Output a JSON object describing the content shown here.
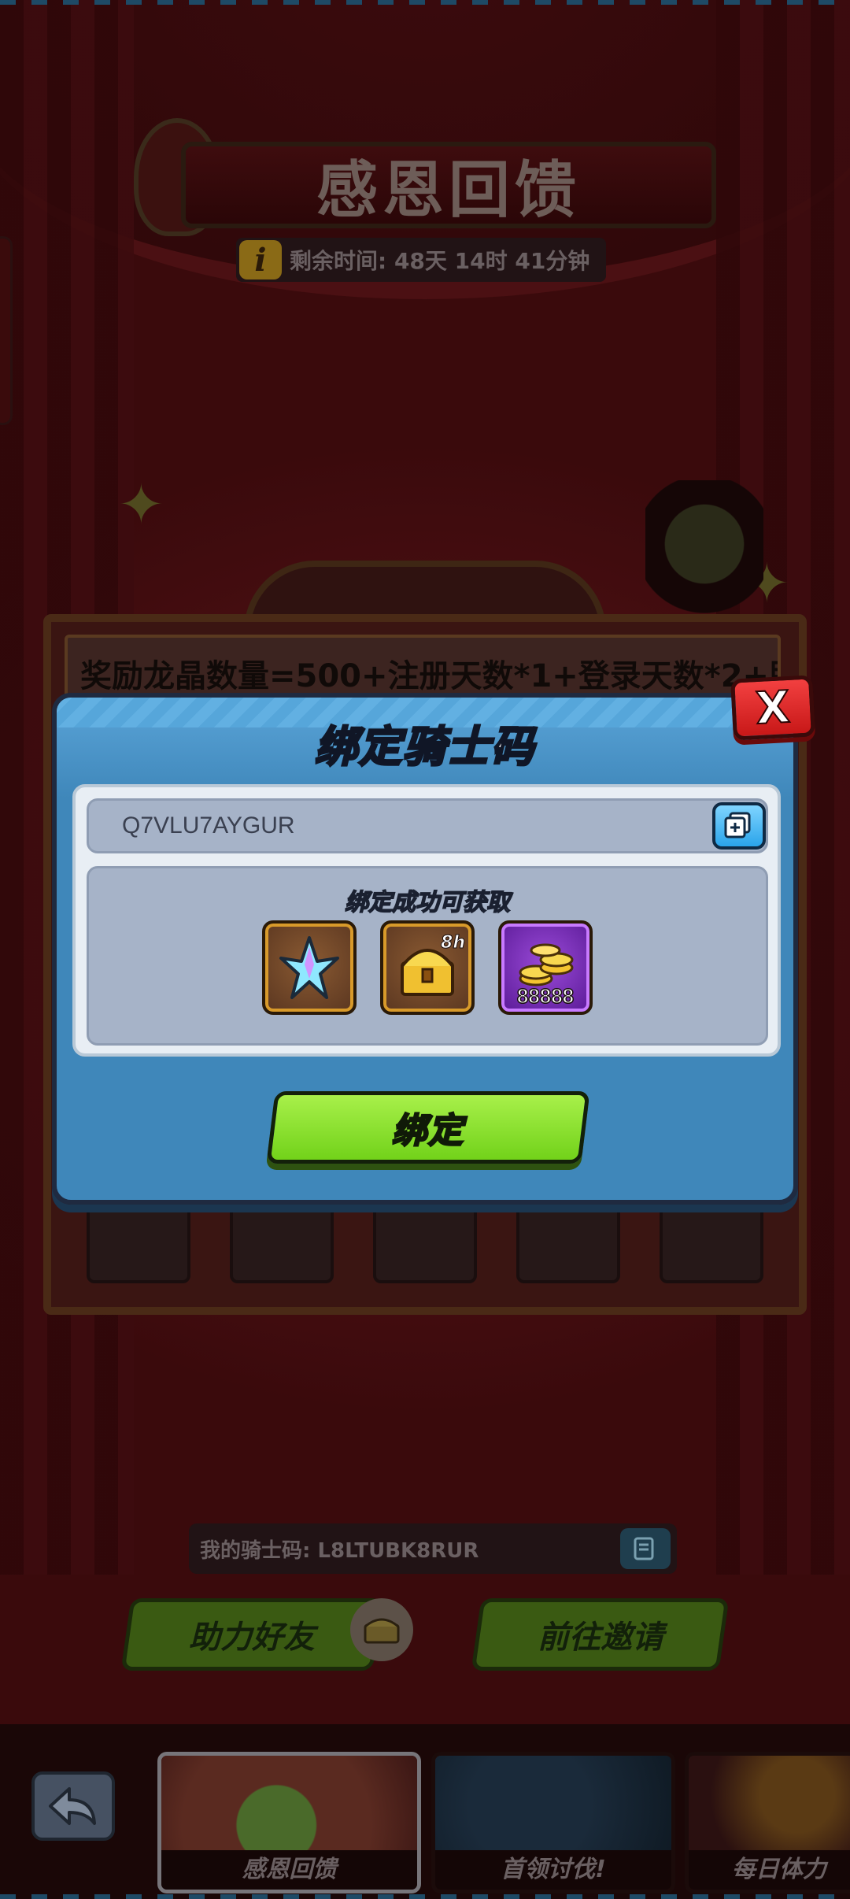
{
  "event": {
    "title": "感恩回馈",
    "timer_text": "剩余时间: 48天 14时 41分钟",
    "formula_text": "奖励龙晶数量=500+注册天数*1+登录天数*2+助"
  },
  "modal": {
    "title": "绑定骑士码",
    "close_label": "X",
    "code_value": "Q7VLU7AYGUR",
    "reward_caption": "绑定成功可获取",
    "rewards": [
      {
        "icon": "crystal-icon",
        "badge": ""
      },
      {
        "icon": "chest-icon",
        "badge": "8h"
      },
      {
        "icon": "gold-coins-icon",
        "count": "88888"
      }
    ],
    "bind_label": "绑定"
  },
  "footer": {
    "my_code_text": "我的骑士码: L8LTUBK8RUR",
    "help_friend_label": "助力好友",
    "invite_label": "前往邀请"
  },
  "tabs": [
    {
      "label": "感恩回馈",
      "active": true
    },
    {
      "label": "首领讨伐!",
      "active": false
    },
    {
      "label": "每日体力",
      "active": false
    }
  ],
  "colors": {
    "modal_blue": "#3f87ba",
    "bind_green": "#8ee436",
    "close_red": "#e02828"
  }
}
